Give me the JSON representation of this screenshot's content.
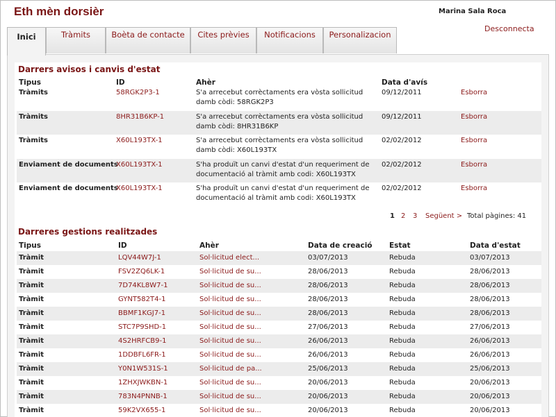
{
  "header": {
    "title": "Eth mèn dorsièr",
    "user": "Marina Sala Roca",
    "logout": "Desconnecta"
  },
  "tabs": [
    {
      "label": "Inici",
      "active": true
    },
    {
      "label": "Tràmits"
    },
    {
      "label": "Boèta de contacte"
    },
    {
      "label": "Cites prèvies"
    },
    {
      "label": "Notificacions"
    },
    {
      "label": "Personalizacion"
    }
  ],
  "notices": {
    "title": "Darrers avisos i canvis d'estat",
    "columns": {
      "type": "Tipus",
      "id": "ID",
      "subject": "Ahèr",
      "date": "Data d'avís"
    },
    "delete_label": "Esborra",
    "rows": [
      {
        "type": "Tràmits",
        "id": "58RGK2P3-1",
        "subject": "S'a arrecebut corrèctaments era vòsta sollicitud damb còdi: 58RGK2P3",
        "date": "09/12/2011"
      },
      {
        "type": "Tràmits",
        "id": "8HR31B6KP-1",
        "subject": "S'a arrecebut corrèctaments era vòsta sollicitud damb còdi: 8HR31B6KP",
        "date": "09/12/2011"
      },
      {
        "type": "Tràmits",
        "id": "X60L193TX-1",
        "subject": "S'a arrecebut corrèctaments era vòsta sollicitud damb còdi: X60L193TX",
        "date": "02/02/2012"
      },
      {
        "type": "Enviament de documents",
        "id": "X60L193TX-1",
        "subject": "S'ha produït un canvi d'estat d'un requeriment de documentació al tràmit amb codi: X60L193TX",
        "date": "02/02/2012"
      },
      {
        "type": "Enviament de documents",
        "id": "X60L193TX-1",
        "subject": "S'ha produït un canvi d'estat d'un requeriment de documentació al tràmit amb codi: X60L193TX",
        "date": "02/02/2012"
      }
    ],
    "pager": {
      "pages": [
        "1",
        "2",
        "3"
      ],
      "next": "Següent >",
      "total": "Total pàgines: 41"
    }
  },
  "procedures": {
    "title": "Darreres gestions realitzades",
    "columns": {
      "type": "Tipus",
      "id": "ID",
      "subject": "Ahèr",
      "created": "Data de creació",
      "status": "Estat",
      "status_date": "Data d'estat"
    },
    "rows": [
      {
        "type": "Tràmit",
        "id": "LQV44W7J-1",
        "subject": "Sol·licitud elect...",
        "created": "03/07/2013",
        "status": "Rebuda",
        "status_date": "03/07/2013"
      },
      {
        "type": "Tràmit",
        "id": "FSV2ZQ6LK-1",
        "subject": "Sol·licitud de su...",
        "created": "28/06/2013",
        "status": "Rebuda",
        "status_date": "28/06/2013"
      },
      {
        "type": "Tràmit",
        "id": "7D74KL8W7-1",
        "subject": "Sol·licitud de su...",
        "created": "28/06/2013",
        "status": "Rebuda",
        "status_date": "28/06/2013"
      },
      {
        "type": "Tràmit",
        "id": "GYNT582T4-1",
        "subject": "Sol·licitud de su...",
        "created": "28/06/2013",
        "status": "Rebuda",
        "status_date": "28/06/2013"
      },
      {
        "type": "Tràmit",
        "id": "BBMF1KGJ7-1",
        "subject": "Sol·licitud de su...",
        "created": "28/06/2013",
        "status": "Rebuda",
        "status_date": "28/06/2013"
      },
      {
        "type": "Tràmit",
        "id": "STC7P9SHD-1",
        "subject": "Sol·licitud de su...",
        "created": "27/06/2013",
        "status": "Rebuda",
        "status_date": "27/06/2013"
      },
      {
        "type": "Tràmit",
        "id": "4S2HRFCB9-1",
        "subject": "Sol·licitud de su...",
        "created": "26/06/2013",
        "status": "Rebuda",
        "status_date": "26/06/2013"
      },
      {
        "type": "Tràmit",
        "id": "1DDBFL6FR-1",
        "subject": "Sol·licitud de su...",
        "created": "26/06/2013",
        "status": "Rebuda",
        "status_date": "26/06/2013"
      },
      {
        "type": "Tràmit",
        "id": "Y0N1W531S-1",
        "subject": "Sol·licitud de pa...",
        "created": "25/06/2013",
        "status": "Rebuda",
        "status_date": "25/06/2013"
      },
      {
        "type": "Tràmit",
        "id": "1ZHXJWKBN-1",
        "subject": "Sol·licitud de su...",
        "created": "20/06/2013",
        "status": "Rebuda",
        "status_date": "20/06/2013"
      },
      {
        "type": "Tràmit",
        "id": "783N4PNNB-1",
        "subject": "Sol·licitud de su...",
        "created": "20/06/2013",
        "status": "Rebuda",
        "status_date": "20/06/2013"
      },
      {
        "type": "Tràmit",
        "id": "59K2VX655-1",
        "subject": "Sol·licitud de su...",
        "created": "20/06/2013",
        "status": "Rebuda",
        "status_date": "20/06/2013"
      }
    ]
  }
}
